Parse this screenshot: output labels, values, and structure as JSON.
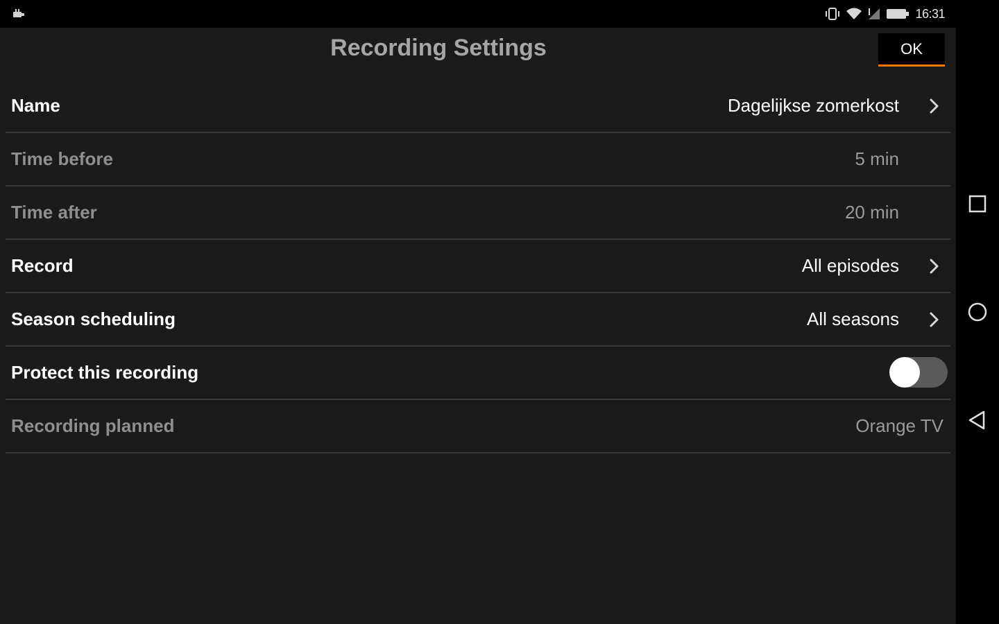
{
  "status_bar": {
    "time": "16:31",
    "icons": [
      "usb-icon",
      "vibrate-icon",
      "wifi-icon",
      "signal-icon",
      "battery-icon"
    ]
  },
  "header": {
    "title": "Recording Settings",
    "ok_label": "OK"
  },
  "colors": {
    "accent": "#ff7900",
    "background": "#1b1b1b",
    "divider": "#3a3a3a"
  },
  "settings": {
    "name": {
      "label": "Name",
      "value": "Dagelijkse zomerkost"
    },
    "time_before": {
      "label": "Time before",
      "value": "5 min"
    },
    "time_after": {
      "label": "Time after",
      "value": "20 min"
    },
    "record": {
      "label": "Record",
      "value": "All episodes"
    },
    "season_scheduling": {
      "label": "Season scheduling",
      "value": "All seasons"
    },
    "protect": {
      "label": "Protect this recording",
      "enabled": false
    },
    "recording_planned": {
      "label": "Recording planned",
      "value": "Orange TV"
    }
  },
  "nav_bar": {
    "buttons": [
      "recent-apps-icon",
      "home-icon",
      "back-icon"
    ]
  }
}
